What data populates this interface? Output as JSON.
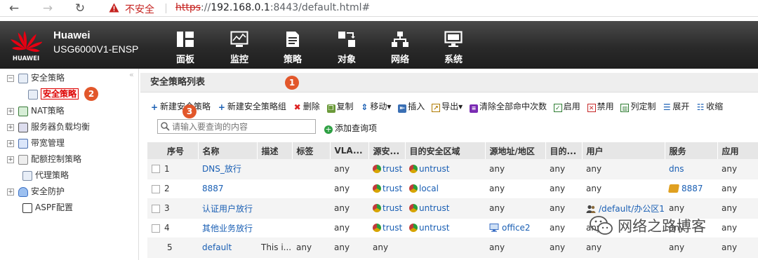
{
  "browser": {
    "back": "←",
    "forward": "→",
    "reload": "↻",
    "security": "不安全",
    "url_scheme": "https",
    "url_rest": "://",
    "url_host": "192.168.0.1",
    "url_path": ":8443/default.html#"
  },
  "header": {
    "brand": "Huawei",
    "model": "USG6000V1-ENSP",
    "logo_text": "HUAWEI",
    "nav": [
      {
        "label": "面板",
        "icon": "panel-icon"
      },
      {
        "label": "监控",
        "icon": "monitor-icon"
      },
      {
        "label": "策略",
        "icon": "policy-icon"
      },
      {
        "label": "对象",
        "icon": "object-icon"
      },
      {
        "label": "网络",
        "icon": "network-icon"
      },
      {
        "label": "系统",
        "icon": "system-icon"
      }
    ],
    "active": "策略"
  },
  "sidebar": {
    "items": [
      {
        "label": "安全策略",
        "expand": "−"
      },
      {
        "label": "安全策略",
        "selected": true
      },
      {
        "label": "NAT策略",
        "expand": "+"
      },
      {
        "label": "服务器负载均衡",
        "expand": "+"
      },
      {
        "label": "带宽管理",
        "expand": "+"
      },
      {
        "label": "配额控制策略",
        "expand": "+"
      },
      {
        "label": "代理策略"
      },
      {
        "label": "安全防护",
        "expand": "+"
      },
      {
        "label": "ASPF配置"
      }
    ],
    "collapse": "«"
  },
  "annotations": {
    "b1": "1",
    "b2": "2",
    "b3": "3"
  },
  "main": {
    "title": "安全策略列表",
    "toolbar": [
      {
        "label": "新建安全策略",
        "icon": "plus-icon",
        "color": "#1a5fb4"
      },
      {
        "label": "新建安全策略组",
        "icon": "plus-icon",
        "color": "#1a5fb4"
      },
      {
        "label": "删除",
        "icon": "delete-icon",
        "color": "#d22"
      },
      {
        "label": "复制",
        "icon": "copy-icon",
        "color": "#2e7d32"
      },
      {
        "label": "移动▾",
        "icon": "move-icon",
        "color": "#1a5fb4"
      },
      {
        "label": "插入",
        "icon": "insert-icon",
        "color": "#1a5fb4"
      },
      {
        "label": "导出▾",
        "icon": "export-icon",
        "color": "#b07a00"
      },
      {
        "label": "清除全部命中次数",
        "icon": "clear-icon",
        "color": "#7a2bb3"
      },
      {
        "label": "启用",
        "icon": "enable-icon",
        "color": "#2e7d32"
      },
      {
        "label": "禁用",
        "icon": "disable-icon",
        "color": "#c62828"
      },
      {
        "label": "列定制",
        "icon": "column-icon",
        "color": "#2e7d32"
      },
      {
        "label": "展开",
        "icon": "expand-icon",
        "color": "#1a5fb4"
      },
      {
        "label": "收缩",
        "icon": "collapse-icon",
        "color": "#1a5fb4"
      }
    ],
    "search_placeholder": "请输入要查询的内容",
    "add_query": "添加查询项",
    "columns": [
      "序号",
      "名称",
      "描述",
      "标签",
      "VLA...",
      "源安...",
      "目的安全区域",
      "源地址/地区",
      "目的...",
      "用户",
      "服务",
      "应用"
    ],
    "rows": [
      {
        "no": "1",
        "name": "DNS_放行",
        "desc": "",
        "tag": "",
        "vlan": "any",
        "src": "trust",
        "dst": "untrust",
        "saddr": "any",
        "daddr": "any",
        "user": "any",
        "service": "dns",
        "app": "any"
      },
      {
        "no": "2",
        "name": "8887",
        "desc": "",
        "tag": "",
        "vlan": "any",
        "src": "trust",
        "dst": "local",
        "saddr": "any",
        "daddr": "any",
        "user": "any",
        "service": "8887",
        "app": "any"
      },
      {
        "no": "3",
        "name": "认证用户放行",
        "desc": "",
        "tag": "",
        "vlan": "any",
        "src": "trust",
        "dst": "untrust",
        "saddr": "any",
        "daddr": "any",
        "user": "/default/办公区1",
        "service": "any",
        "app": "any"
      },
      {
        "no": "4",
        "name": "其他业务放行",
        "desc": "",
        "tag": "",
        "vlan": "any",
        "src": "trust",
        "dst": "untrust",
        "saddr": "office2",
        "daddr": "any",
        "user": "any",
        "service": "any",
        "app": "any"
      },
      {
        "no": "5",
        "name": "default",
        "desc": "This i...",
        "tag": "any",
        "vlan": "any",
        "src": "any",
        "dst": "",
        "saddr": "any",
        "daddr": "any",
        "user": "any",
        "service": "any",
        "app": "any"
      }
    ]
  },
  "watermark": "网络之路博客",
  "colors": {
    "brand_red": "#e60012",
    "badge": "#e2572b",
    "link": "#1a5fb4"
  }
}
